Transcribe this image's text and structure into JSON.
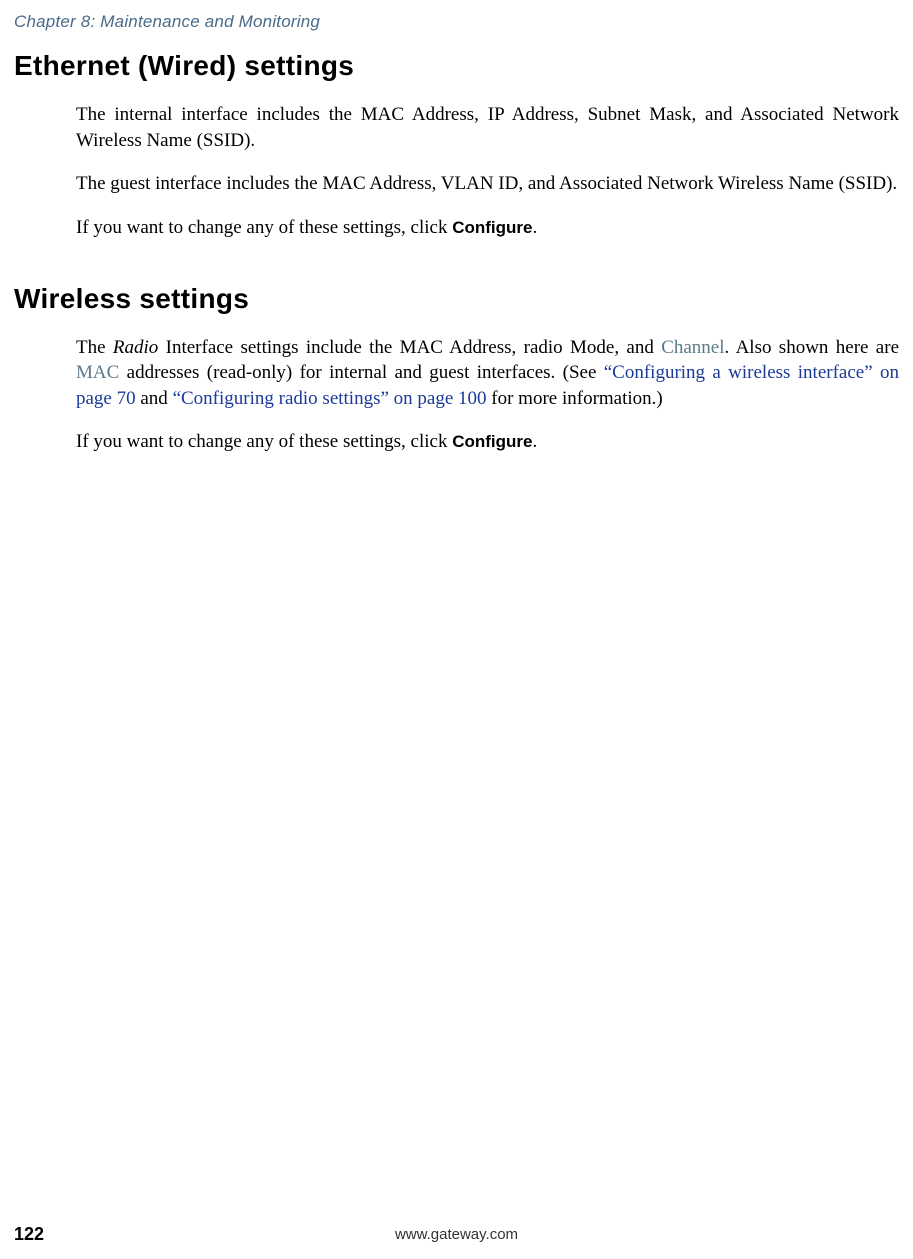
{
  "header": {
    "chapter_label": "Chapter 8: Maintenance and Monitoring"
  },
  "sections": {
    "ethernet": {
      "heading": "Ethernet (Wired) settings",
      "p1": "The internal interface includes the MAC Address, IP Address, Subnet Mask, and Associated Network Wireless Name (SSID).",
      "p2": "The guest interface includes the MAC Address, VLAN ID, and Associated Network Wireless Name (SSID).",
      "p3_pre": "If you want to change any of these settings, click ",
      "p3_configure": "Configure",
      "p3_post": "."
    },
    "wireless": {
      "heading": "Wireless settings",
      "p1_pre": "The ",
      "p1_radio": "Radio",
      "p1_mid1": " Interface settings include the MAC Address, radio Mode, and ",
      "p1_channel": "Channel",
      "p1_mid2": ". Also shown here are ",
      "p1_mac": "MAC",
      "p1_mid3": " addresses (read-only) for internal and guest interfaces. (See ",
      "p1_link1": "“Configuring a wireless interface” on page 70",
      "p1_and": " and ",
      "p1_link2": "“Configuring radio settings” on page 100",
      "p1_post": " for more information.)",
      "p2_pre": "If you want to change any of these settings, click ",
      "p2_configure": "Configure",
      "p2_post": "."
    }
  },
  "footer": {
    "page_number": "122",
    "url": "www.gateway.com"
  }
}
